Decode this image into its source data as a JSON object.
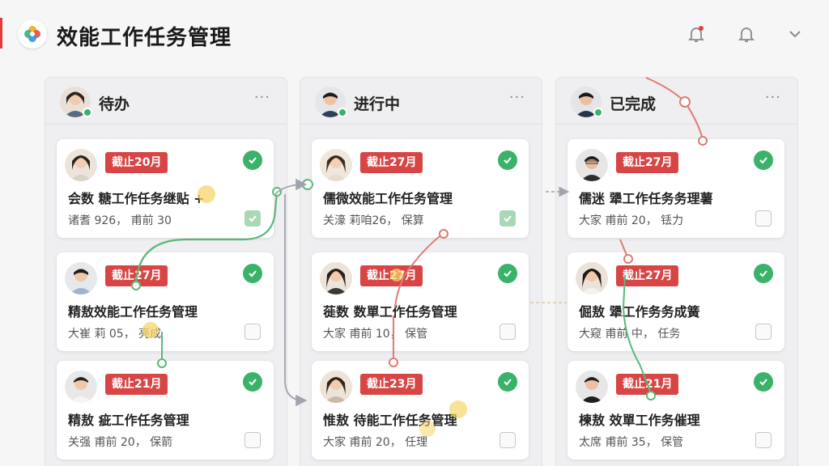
{
  "header": {
    "title": "效能工作任务管理"
  },
  "icons": {
    "logo": "flower-logo-icon",
    "notify_alert": "bell-alert-icon",
    "notify": "bell-icon",
    "menu": "chevron-down-icon"
  },
  "colors": {
    "accent": "#d84545",
    "done": "#3bb26a"
  },
  "columns": [
    {
      "title": "待办",
      "more": "···",
      "cards": [
        {
          "tag": "截止20月",
          "title": "会数 糖工作任务继贴 +",
          "meta": "诸耆 926， 甫前 30",
          "done_checked": true
        },
        {
          "tag": "截止27月",
          "title": "精敖效能工作任务管理",
          "meta": "大崔 莉 05， 亮成",
          "done_checked": false
        },
        {
          "tag": "截止21月",
          "title": "精敖 疵工作任务管理",
          "meta": "关强 甫前 20， 保箭",
          "done_checked": false
        }
      ]
    },
    {
      "title": "进行中",
      "more": "···",
      "cards": [
        {
          "tag": "截止27月",
          "title": "儒微效能工作任务管理",
          "meta": "关濠 莉咱26， 保算",
          "done_checked": true
        },
        {
          "tag": "截止27月",
          "title": "蓰数 数單工作任务管理",
          "meta": "大家 甫前 10， 保管",
          "done_checked": false
        },
        {
          "tag": "截止23月",
          "title": "惟敖 待能工作任务管理",
          "meta": "大家 甫前 20， 任理",
          "done_checked": false
        }
      ]
    },
    {
      "title": "已完成",
      "more": "···",
      "cards": [
        {
          "tag": "截止27月",
          "title": "儒迷 犟工作任务务理薯",
          "meta": "大家 甫前 20， 铥力",
          "done_checked": false
        },
        {
          "tag": "截止27月",
          "title": "倔敖 犟工作务务成簧",
          "meta": "大窥 甫前 中， 任务",
          "done_checked": false
        },
        {
          "tag": "截止21月",
          "title": "楝敖 效單工作务催理",
          "meta": "太席 甫前 35， 保管",
          "done_checked": false
        }
      ]
    }
  ]
}
